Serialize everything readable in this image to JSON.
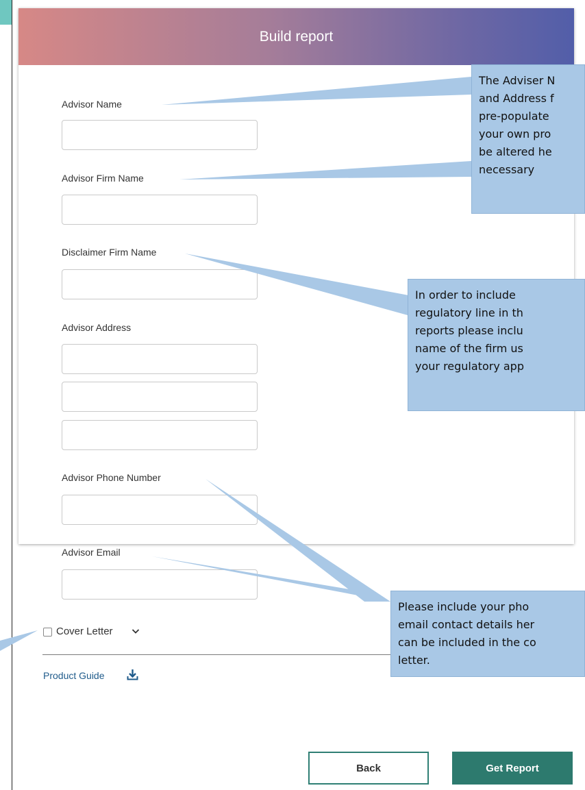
{
  "header": {
    "title": "Build report"
  },
  "form": {
    "advisor_name_label": "Advisor Name",
    "advisor_firm_name_label": "Advisor Firm Name",
    "disclaimer_firm_name_label": "Disclaimer Firm Name",
    "advisor_address_label": "Advisor Address",
    "advisor_phone_label": "Advisor Phone Number",
    "advisor_email_label": "Advisor Email",
    "cover_letter_label": "Cover Letter",
    "product_guide_label": "Product Guide"
  },
  "buttons": {
    "back": "Back",
    "get_report": "Get Report"
  },
  "callouts": {
    "advisor_details": [
      "The Adviser N",
      "and Address f",
      "pre-populate",
      "your own pro",
      "be altered he",
      "necessary"
    ],
    "regulatory": [
      "In order to include",
      "regulatory line in th",
      "reports please inclu",
      "name of the firm us",
      "your regulatory app"
    ],
    "contact": [
      "Please include your pho",
      "email contact details her",
      "can be included in the co",
      "letter."
    ]
  },
  "colors": {
    "header_gradient_start": "#d68886",
    "header_gradient_end": "#525ea9",
    "primary_button": "#2d7a6e",
    "callout_fill": "#a9c8e6",
    "link": "#1f5b8b"
  }
}
